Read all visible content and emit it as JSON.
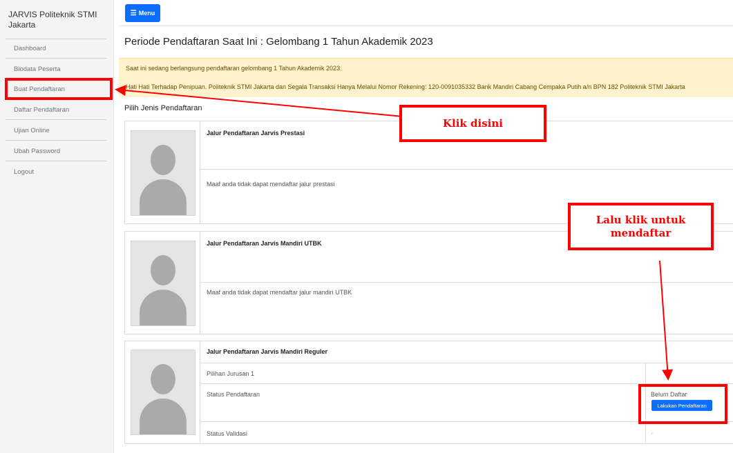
{
  "sidebar": {
    "brand": "JARVIS Politeknik STMI Jakarta",
    "items": [
      {
        "label": "Dashboard"
      },
      {
        "label": "Biodata Peserta"
      },
      {
        "label": "Buat Pendaftaran"
      },
      {
        "label": "Daftar Pendaftaran"
      },
      {
        "label": "Ujian Online"
      },
      {
        "label": "Ubah Password"
      },
      {
        "label": "Logout"
      }
    ]
  },
  "toolbar": {
    "menu_label": "Menu",
    "menu_icon": "bars-icon"
  },
  "page": {
    "title": "Periode Pendaftaran Saat Ini : Gelombang 1 Tahun Akademik 2023",
    "alert_line1": "Saat ini sedang berlangsung pendaftaran gelombang 1 Tahun Akademik 2023.",
    "alert_line2": "Hati Hati Terhadap Penipuan. Politeknik STMI Jakarta dan Segala Transaksi Hanya Melalui Nomor Rekening: 120-0091035332 Bank Mandiri Cabang Cempaka Putih a/n BPN 182 Politeknik STMI Jakarta",
    "section_label": "Pilih Jenis Pendaftaran"
  },
  "cards": [
    {
      "title": "Jalur Pendaftaran Jarvis Prestasi",
      "message": "Maaf anda tidak dapat mendaftar jalur prestasi"
    },
    {
      "title": "Jalur Pendaftaran Jarvis Mandiri UTBK",
      "message": "Maaf anda tidak dapat mendaftar jalur mandiri UTBK"
    },
    {
      "title": "Jalur Pendaftaran Jarvis Mandiri Reguler",
      "rows": {
        "pilihan_label": "Pilihan Jurusan 1",
        "pilihan_value": "",
        "status_label": "Status Pendaftaran",
        "status_value": "Belum Daftar",
        "button_label": "Lakukan Pendaftaran",
        "validasi_label": "Status Validasi",
        "validasi_value": "-"
      }
    }
  ],
  "annotations": {
    "callout1": "Klik disini",
    "callout2": "Lalu klik untuk mendaftar",
    "color": "#ff0000"
  },
  "colors": {
    "primary": "#0d6efd",
    "alert_bg": "#fff3cd",
    "sidebar_bg": "#f4f4f4"
  }
}
